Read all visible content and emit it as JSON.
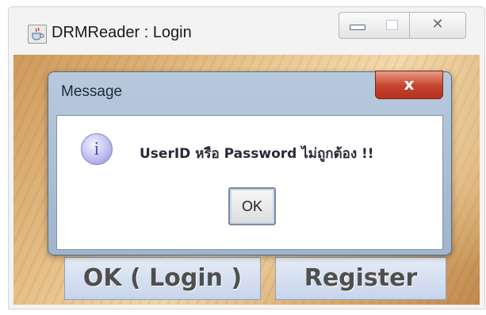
{
  "window": {
    "title": "DRMReader : Login",
    "icon": "java-cup-icon",
    "controls": {
      "close_glyph": "✕"
    }
  },
  "main": {
    "login_button": "OK ( Login )",
    "register_button": "Register"
  },
  "dialog": {
    "title": "Message",
    "close_glyph": "x",
    "icon": "info-icon",
    "icon_glyph": "i",
    "message": "UserID หรือ Password ไม่ถูกต้อง !!",
    "ok_label": "OK"
  },
  "colors": {
    "close_button": "#c4432c",
    "dialog_frame": "#b7c9dd",
    "wood": "#e6c189"
  }
}
